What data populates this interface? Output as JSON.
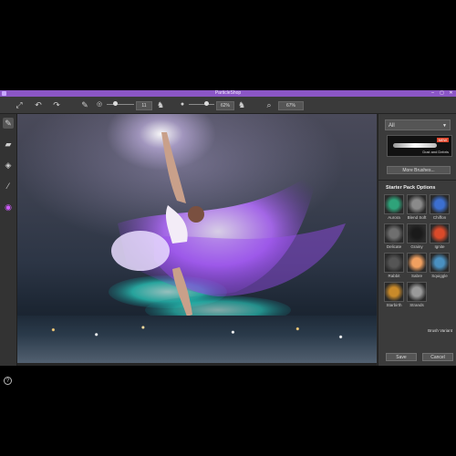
{
  "window": {
    "title": "ParticleShop",
    "minimize_icon": "minimize-icon",
    "maximize_icon": "maximize-icon",
    "close_icon": "close-icon",
    "accent": "#8b56c6"
  },
  "toolbar": {
    "brush_size_value": "11",
    "opacity_value": "62%",
    "zoom_value": "67%"
  },
  "right_panel": {
    "category_value": "All",
    "brush_preview_name": "Dust and Debris",
    "brush_preview_badge": "NEW",
    "more_brushes_label": "More Brushes...",
    "starter_header": "Starter Pack Options",
    "brushes": [
      {
        "label": "Aurora",
        "color": "#2fa37a"
      },
      {
        "label": "Blend Soft",
        "color": "#8a8a8a"
      },
      {
        "label": "Chiffon",
        "color": "#3c6fd0"
      },
      {
        "label": "Delicate",
        "color": "#6f6f6f"
      },
      {
        "label": "Grainy",
        "color": "#1a1a1a"
      },
      {
        "label": "Ignite",
        "color": "#d94a2a"
      },
      {
        "label": "Rabbit",
        "color": "#555555"
      },
      {
        "label": "Sabre",
        "color": "#f0a060"
      },
      {
        "label": "Squiggle",
        "color": "#4a90c0"
      },
      {
        "label": "Starbirth",
        "color": "#c98a2a"
      },
      {
        "label": "Strands",
        "color": "#9a9a9a"
      }
    ],
    "brush_variant_label": "Brush Variant",
    "save_label": "Save",
    "cancel_label": "Cancel"
  },
  "left_tools": [
    "brush-icon",
    "eraser-icon",
    "fill-icon",
    "eyedropper-icon",
    "color-wheel-icon"
  ],
  "help_label": "?"
}
